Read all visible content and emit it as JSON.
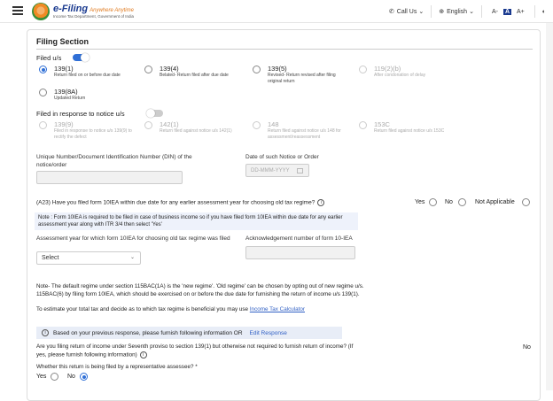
{
  "header": {
    "brand": "e-Filing",
    "tagline": "Anywhere Anytime",
    "subtitle": "Income Tax Department, Government of India",
    "call_us": "Call Us",
    "language": "English",
    "font_small": "A-",
    "font_normal": "A",
    "font_large": "A+"
  },
  "section": {
    "title": "Filing Section",
    "filed_us_label": "Filed u/s",
    "options": [
      {
        "title": "139(1)",
        "desc": "Return filed on or before due date"
      },
      {
        "title": "139(4)",
        "desc": "Belated- Return filed after due date"
      },
      {
        "title": "139(5)",
        "desc": "Revised- Return revised after filing original return"
      },
      {
        "title": "119(2)(b)",
        "desc": "After condonation of delay"
      },
      {
        "title": "139(8A)",
        "desc": "Updated Return"
      }
    ],
    "notice_label": "Filed in response to notice u/s",
    "notice_options": [
      {
        "title": "139(9)",
        "desc": "Filed in response to notice u/s 139(9) to rectify the defect"
      },
      {
        "title": "142(1)",
        "desc": "Return filed against notice u/s 142(1)"
      },
      {
        "title": "148",
        "desc": "Return filed against notice u/s 148 for assessment/reassessment"
      },
      {
        "title": "153C",
        "desc": "Return filed against notice u/s 153C"
      }
    ],
    "din_label": "Unique Number/Document Identification Number (DIN) of the notice/order",
    "date_label": "Date of such Notice or Order",
    "date_placeholder": "DD-MMM-YYYY"
  },
  "a23": {
    "question": "(A23) Have you filed form 10IEA within due date for any earlier assessment year for choosing old tax regime?",
    "yes": "Yes",
    "no": "No",
    "na": "Not Applicable",
    "note": "Note : Form 10IEA is required to be filed in case of business income so if you have filed form 10IEA within due date for any earlier assessment year along with ITR 3/4 then select 'Yes'",
    "ay_label": "Assessment year for which form 10IEA for choosing old tax regime was filed",
    "ay_select": "Select",
    "ack_label": "Acknowledgement number of form 10-IEA"
  },
  "regime": {
    "note": "Note- The default regime under section 115BAC(1A) is the 'new regime'. 'Old regime' can be chosen by opting out of new regime u/s. 115BAC(6) by filing form 10IEA, which should be exercised on or before the due date for furnishing the return of income u/s 139(1).",
    "estimate": "To estimate your total tax and decide as to which tax regime is beneficial you may use",
    "calculator_link": "Income Tax Calculator"
  },
  "info_bar": {
    "text": "Based on your previous response, please furnish following information OR",
    "edit": "Edit Response"
  },
  "seventh": {
    "question": "Are you filing return of income under Seventh proviso to section 139(1) but otherwise not required to furnish return of income? (If yes, please furnish following information)",
    "answer": "No"
  },
  "rep": {
    "question": "Whether this return is being filed by a representative assessee? *",
    "yes": "Yes",
    "no": "No"
  }
}
